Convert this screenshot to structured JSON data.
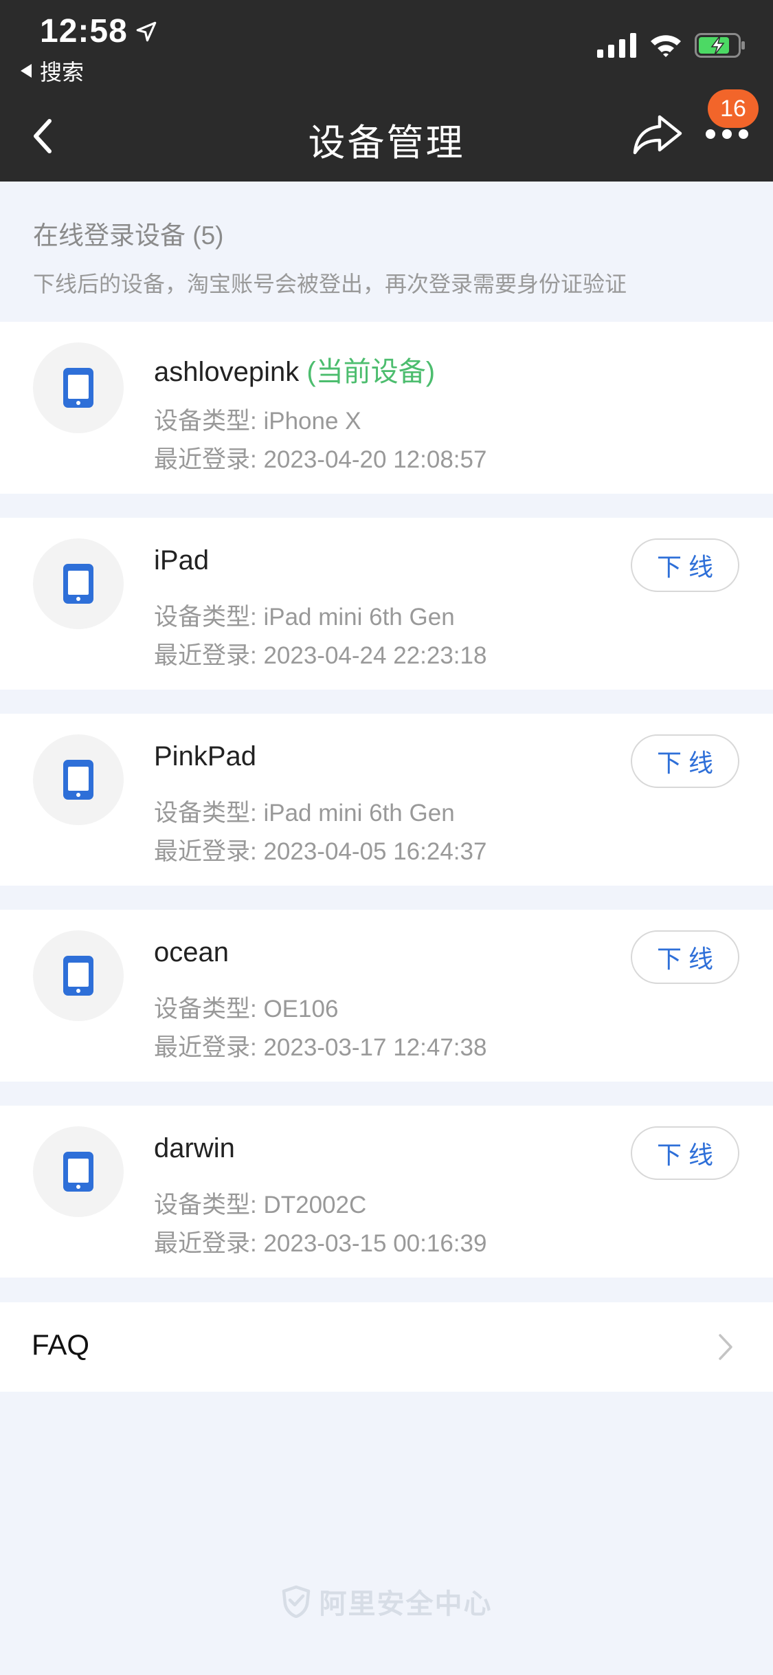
{
  "status_bar": {
    "time": "12:58",
    "back_app_label": "搜索"
  },
  "nav": {
    "title": "设备管理",
    "badge_count": "16",
    "icons": [
      "back-chevron-icon",
      "share-icon",
      "more-dots-icon"
    ]
  },
  "section": {
    "title": "在线登录设备 (5)",
    "note": "下线后的设备，淘宝账号会被登出，再次登录需要身份证验证"
  },
  "devices": [
    {
      "name": "ashlovepink",
      "current_tag": "(当前设备)",
      "type_label": "设备类型: iPhone X",
      "login_label": "最近登录: 2023-04-20 12:08:57",
      "offline_label": ""
    },
    {
      "name": "iPad",
      "current_tag": "",
      "type_label": "设备类型: iPad mini 6th Gen",
      "login_label": "最近登录: 2023-04-24 22:23:18",
      "offline_label": "下线"
    },
    {
      "name": "PinkPad",
      "current_tag": "",
      "type_label": "设备类型: iPad mini 6th Gen",
      "login_label": "最近登录: 2023-04-05 16:24:37",
      "offline_label": "下线"
    },
    {
      "name": "ocean",
      "current_tag": "",
      "type_label": "设备类型: OE106",
      "login_label": "最近登录: 2023-03-17 12:47:38",
      "offline_label": "下线"
    },
    {
      "name": "darwin",
      "current_tag": "",
      "type_label": "设备类型: DT2002C",
      "login_label": "最近登录: 2023-03-15 00:16:39",
      "offline_label": "下线"
    }
  ],
  "faq": {
    "label": "FAQ"
  },
  "footer": {
    "brand": "阿里安全中心"
  },
  "colors": {
    "header_bg": "#2b2b2b",
    "page_bg": "#f1f4fb",
    "accent_blue": "#2e6fd8",
    "current_green": "#4cbd6e",
    "badge_orange": "#f2652a",
    "battery_green": "#4cd964"
  }
}
